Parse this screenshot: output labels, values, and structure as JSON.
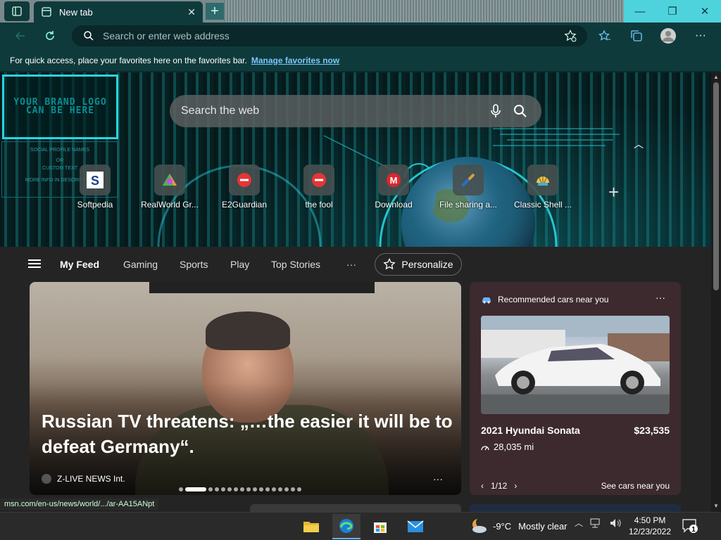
{
  "tab": {
    "title": "New tab"
  },
  "address": {
    "placeholder": "Search or enter web address"
  },
  "favorites_bar": {
    "message": "For quick access, place your favorites here on the favorites bar.",
    "link": "Manage favorites now"
  },
  "hero": {
    "brand_logo_text": "YOUR BRAND LOGO CAN BE HERE",
    "social_text": [
      "SOCIAL PROFILE NAMES",
      "OR",
      "CUSTOM TEXT",
      "MORE INFO IN DESCRIPTION"
    ],
    "search_placeholder": "Search the web"
  },
  "quick_links": [
    {
      "name": "Softpedia",
      "icon": "softpedia-icon"
    },
    {
      "name": "RealWorld Gr...",
      "icon": "realworld-icon"
    },
    {
      "name": "E2Guardian",
      "icon": "blocked-icon"
    },
    {
      "name": "the fool",
      "icon": "blocked-icon"
    },
    {
      "name": "Download",
      "icon": "mega-icon"
    },
    {
      "name": "File sharing a...",
      "icon": "file-sharing-icon"
    },
    {
      "name": "Classic Shell ...",
      "icon": "classic-shell-icon"
    }
  ],
  "feed_nav": {
    "items": [
      "My Feed",
      "Gaming",
      "Sports",
      "Play",
      "Top Stories"
    ],
    "more": "···",
    "personalize": "Personalize"
  },
  "main_story": {
    "headline": "Russian TV threatens: „…the easier it will be to defeat Germany“.",
    "source": "Z-LIVE NEWS Int.",
    "more": "···"
  },
  "car_card": {
    "header": "Recommended cars near you",
    "more": "···",
    "name": "2021 Hyundai Sonata",
    "price": "$23,535",
    "miles": "28,035 mi",
    "pager": "1/12",
    "see_more": "See cars near you"
  },
  "status_url": "msn.com/en-us/news/world/.../ar-AA15ANpt",
  "taskbar": {
    "weather_temp": "-9°C",
    "weather_cond": "Mostly clear",
    "time": "4:50 PM",
    "date": "12/23/2022",
    "notifications": "1"
  },
  "colors": {
    "accent": "#2ad4e0",
    "chrome": "#0f3a3c",
    "link": "#79c7ff"
  }
}
